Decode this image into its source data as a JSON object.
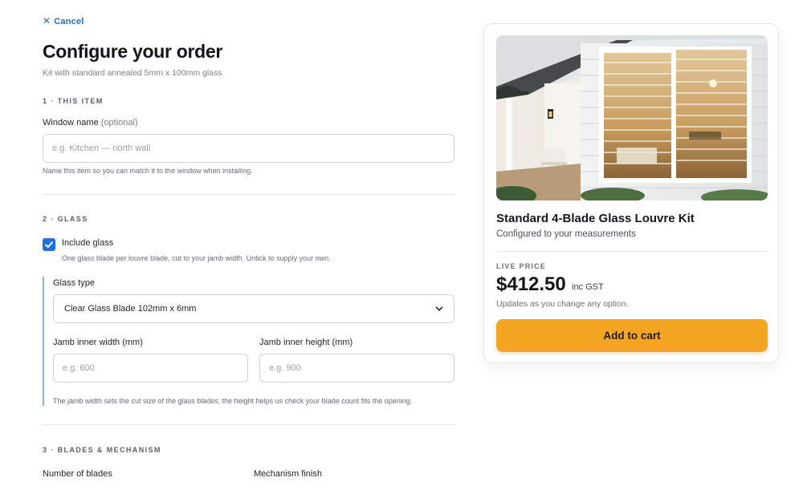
{
  "header": {
    "cancel_label": "Cancel",
    "title": "Configure your order",
    "subtitle": "Kit with standard annealed 5mm x 100mm glass"
  },
  "section1": {
    "label": "1 · THIS ITEM",
    "window_name_label": "Window name",
    "window_name_optional": "(optional)",
    "window_name_placeholder": "e.g. Kitchen — north wall",
    "window_name_helper": "Name this item so you can match it to the window when installing."
  },
  "section2": {
    "label": "2 · GLASS",
    "include_glass_label": "Include glass",
    "include_glass_checked": true,
    "include_glass_helper": "One glass blade per louvre blade, cut to your jamb width. Untick to supply your own.",
    "glass_type_label": "Glass type",
    "glass_type_value": "Clear Glass Blade 102mm x 6mm",
    "jamb_width_label": "Jamb inner width (mm)",
    "jamb_width_placeholder": "e.g. 600",
    "jamb_height_label": "Jamb inner height (mm)",
    "jamb_height_placeholder": "e.g. 900",
    "jamb_helper": "The jamb width sets the cut size of the glass blades; the height helps us check your blade count fits the opening."
  },
  "section3": {
    "label": "3 · BLADES & MECHANISM",
    "blades_label": "Number of blades",
    "mechanism_label": "Mechanism finish"
  },
  "product": {
    "title": "Standard 4-Blade Glass Louvre Kit",
    "subtitle": "Configured to your measurements",
    "live_price_label": "LIVE PRICE",
    "price": "$412.50",
    "price_suffix": "inc GST",
    "price_note": "Updates as you change any option.",
    "add_to_cart_label": "Add to cart"
  },
  "colors": {
    "accent_blue": "#1f6fde",
    "cart_button": "#f4a623",
    "link": "#2a6fb0"
  }
}
